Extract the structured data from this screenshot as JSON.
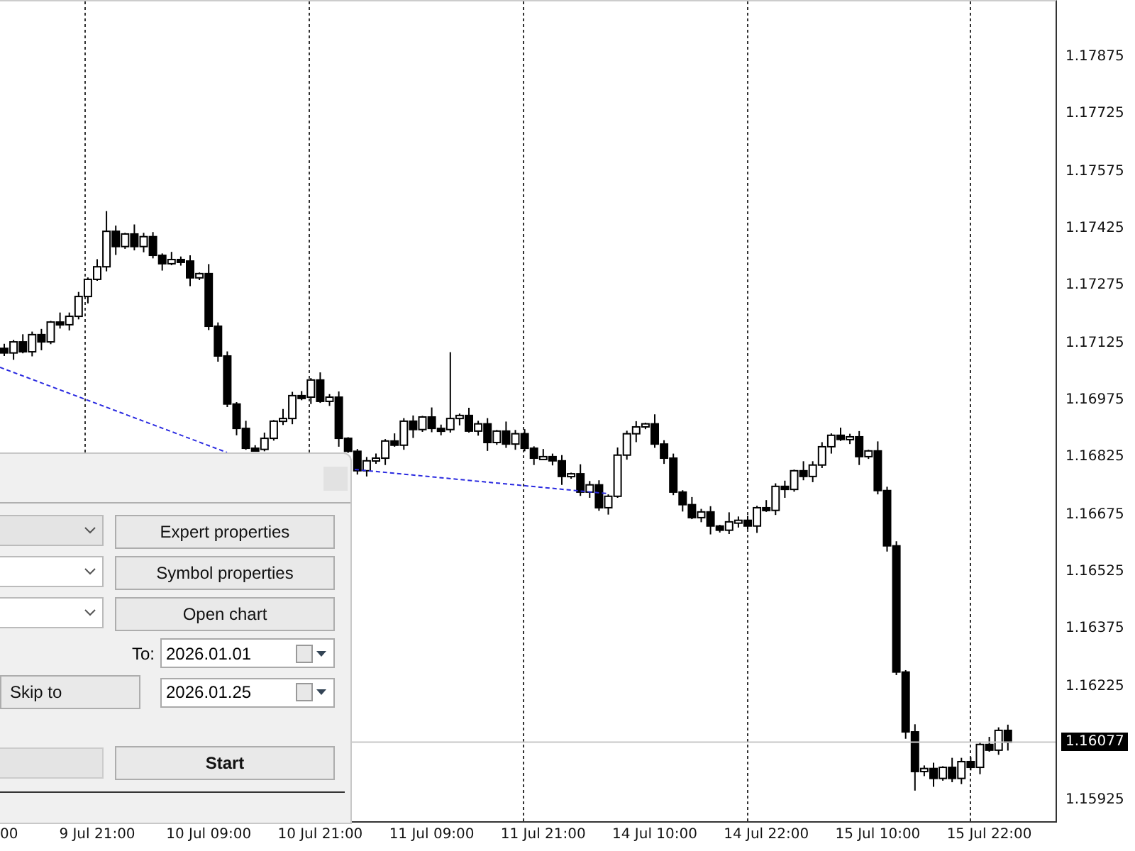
{
  "chart": {
    "chart_data": {
      "type": "candlestick",
      "ylim": [
        1.15866,
        1.1802
      ],
      "categories": [
        null,
        null,
        null,
        null,
        null,
        null,
        null,
        null,
        null,
        null,
        "9 Jul 21:00",
        null,
        null,
        null,
        null,
        null,
        null,
        null,
        null,
        null,
        null,
        null,
        "10 Jul 09:00",
        null,
        null,
        null,
        null,
        null,
        null,
        null,
        null,
        null,
        null,
        null,
        "10 Jul 21:00",
        null,
        null,
        null,
        null,
        null,
        null,
        null,
        null,
        null,
        null,
        null,
        "11 Jul 09:00",
        null,
        null,
        null,
        null,
        null,
        null,
        null,
        null,
        null,
        null,
        null,
        "11 Jul 21:00",
        null,
        null,
        null,
        null,
        null,
        null,
        null,
        null,
        null,
        null,
        null,
        "14 Jul 10:00",
        null,
        null,
        null,
        null,
        null,
        null,
        null,
        null,
        null,
        null,
        null,
        "14 Jul 22:00",
        null,
        null,
        null,
        null,
        null,
        null,
        null,
        null,
        null,
        null,
        null,
        "15 Jul 10:00",
        null,
        null,
        null,
        null,
        null,
        null,
        null,
        null,
        null,
        null,
        null,
        "15 Jul 22:00",
        null,
        null
      ],
      "ohlc": [
        [
          1.1711,
          1.17122,
          1.1709,
          1.17098
        ],
        [
          1.17098,
          1.17132,
          1.1708,
          1.17127
        ],
        [
          1.17127,
          1.17147,
          1.17097,
          1.17101
        ],
        [
          1.17101,
          1.17154,
          1.17089,
          1.17146
        ],
        [
          1.17146,
          1.17161,
          1.17105,
          1.17127
        ],
        [
          1.17127,
          1.17182,
          1.17121,
          1.17179
        ],
        [
          1.17179,
          1.17204,
          1.17162,
          1.17172
        ],
        [
          1.17172,
          1.17204,
          1.17157,
          1.17194
        ],
        [
          1.17194,
          1.17258,
          1.17186,
          1.17246
        ],
        [
          1.17246,
          1.17296,
          1.17228,
          1.17291
        ],
        [
          1.17291,
          1.17344,
          1.17287,
          1.17324
        ],
        [
          1.17324,
          1.1747,
          1.17312,
          1.17417
        ],
        [
          1.17417,
          1.17432,
          1.17355,
          1.17377
        ],
        [
          1.17377,
          1.17413,
          1.17371,
          1.1741
        ],
        [
          1.1741,
          1.17435,
          1.17367,
          1.17377
        ],
        [
          1.17377,
          1.17413,
          1.17362,
          1.17403
        ],
        [
          1.17403,
          1.17415,
          1.17346,
          1.17354
        ],
        [
          1.17354,
          1.17359,
          1.17314,
          1.17332
        ],
        [
          1.17332,
          1.17363,
          1.17328,
          1.17343
        ],
        [
          1.17343,
          1.17351,
          1.17327,
          1.17339
        ],
        [
          1.17339,
          1.17354,
          1.17273,
          1.17295
        ],
        [
          1.17295,
          1.17309,
          1.17289,
          1.17306
        ],
        [
          1.17306,
          1.17331,
          1.17158,
          1.17168
        ],
        [
          1.17168,
          1.17178,
          1.17075,
          1.1709
        ],
        [
          1.1709,
          1.17102,
          1.16956,
          1.16964
        ],
        [
          1.16964,
          1.16969,
          1.16882,
          1.169
        ],
        [
          1.169,
          1.1692,
          1.16844,
          1.16848
        ],
        [
          1.16848,
          1.16856,
          1.1684,
          1.16845
        ],
        [
          1.16845,
          1.16889,
          1.1684,
          1.16874
        ],
        [
          1.16874,
          1.16922,
          1.16868,
          1.16919
        ],
        [
          1.16919,
          1.16951,
          1.16909,
          1.16926
        ],
        [
          1.16926,
          1.16996,
          1.16911,
          1.16986
        ],
        [
          1.16986,
          1.16998,
          1.16974,
          1.16982
        ],
        [
          1.16982,
          1.17032,
          1.16964,
          1.17027
        ],
        [
          1.17027,
          1.17047,
          1.16967,
          1.16971
        ],
        [
          1.16971,
          1.1699,
          1.16959,
          1.16982
        ],
        [
          1.16982,
          1.16997,
          1.16852,
          1.16874
        ],
        [
          1.16874,
          1.16877,
          1.16836,
          1.1684
        ],
        [
          1.1684,
          1.16846,
          1.16779,
          1.16789
        ],
        [
          1.16789,
          1.16825,
          1.16774,
          1.16815
        ],
        [
          1.16815,
          1.16834,
          1.16807,
          1.16822
        ],
        [
          1.16822,
          1.16872,
          1.16804,
          1.16867
        ],
        [
          1.16867,
          1.16887,
          1.16852,
          1.16856
        ],
        [
          1.16856,
          1.16927,
          1.16844,
          1.16919
        ],
        [
          1.16919,
          1.16934,
          1.16875,
          1.16897
        ],
        [
          1.16897,
          1.16933,
          1.16891,
          1.1693
        ],
        [
          1.1693,
          1.16955,
          1.1689,
          1.169
        ],
        [
          1.169,
          1.1691,
          1.16882,
          1.16897
        ],
        [
          1.16897,
          1.171,
          1.16889,
          1.16926
        ],
        [
          1.16926,
          1.16939,
          1.16908,
          1.16934
        ],
        [
          1.16934,
          1.16954,
          1.16889,
          1.16893
        ],
        [
          1.16893,
          1.1692,
          1.16881,
          1.16912
        ],
        [
          1.16912,
          1.16927,
          1.16841,
          1.16863
        ],
        [
          1.16863,
          1.16896,
          1.16857,
          1.16893
        ],
        [
          1.16893,
          1.16918,
          1.16849,
          1.16859
        ],
        [
          1.16859,
          1.16896,
          1.16844,
          1.16886
        ],
        [
          1.16886,
          1.16898,
          1.1684,
          1.16848
        ],
        [
          1.16848,
          1.16853,
          1.16804,
          1.16822
        ],
        [
          1.16822,
          1.16846,
          1.16818,
          1.16826
        ],
        [
          1.16826,
          1.16834,
          1.16803,
          1.16815
        ],
        [
          1.16815,
          1.1683,
          1.16752,
          1.16774
        ],
        [
          1.16774,
          1.16784,
          1.16768,
          1.16781
        ],
        [
          1.16781,
          1.16806,
          1.16723,
          1.16733
        ],
        [
          1.16733,
          1.16762,
          1.16718,
          1.16752
        ],
        [
          1.16752,
          1.16764,
          1.16684,
          1.16692
        ],
        [
          1.16692,
          1.16727,
          1.16674,
          1.16722
        ],
        [
          1.16722,
          1.1685,
          1.16718,
          1.1683
        ],
        [
          1.1683,
          1.16894,
          1.16818,
          1.16886
        ],
        [
          1.16886,
          1.16919,
          1.16864,
          1.16904
        ],
        [
          1.16904,
          1.16915,
          1.16898,
          1.16912
        ],
        [
          1.16912,
          1.16937,
          1.16849,
          1.16859
        ],
        [
          1.16859,
          1.16869,
          1.16807,
          1.16822
        ],
        [
          1.16822,
          1.16834,
          1.16725,
          1.16733
        ],
        [
          1.16733,
          1.16738,
          1.16682,
          1.167
        ],
        [
          1.167,
          1.1672,
          1.16662,
          1.16666
        ],
        [
          1.16666,
          1.16689,
          1.16654,
          1.16681
        ],
        [
          1.16681,
          1.16696,
          1.16622,
          1.16644
        ],
        [
          1.16644,
          1.16647,
          1.16627,
          1.16633
        ],
        [
          1.16633,
          1.1668,
          1.16623,
          1.16655
        ],
        [
          1.16655,
          1.16669,
          1.1664,
          1.16659
        ],
        [
          1.16659,
          1.16671,
          1.16636,
          1.16644
        ],
        [
          1.16644,
          1.16697,
          1.16626,
          1.16692
        ],
        [
          1.16692,
          1.16712,
          1.16681,
          1.16685
        ],
        [
          1.16685,
          1.16756,
          1.16673,
          1.16748
        ],
        [
          1.16748,
          1.16763,
          1.16718,
          1.1674
        ],
        [
          1.1674,
          1.16792,
          1.16734,
          1.16789
        ],
        [
          1.16789,
          1.16814,
          1.16764,
          1.16774
        ],
        [
          1.16774,
          1.16814,
          1.16759,
          1.16804
        ],
        [
          1.16804,
          1.16864,
          1.16796,
          1.16852
        ],
        [
          1.16852,
          1.16887,
          1.16834,
          1.16882
        ],
        [
          1.16882,
          1.16902,
          1.16867,
          1.16871
        ],
        [
          1.16871,
          1.16886,
          1.16859,
          1.16878
        ],
        [
          1.16878,
          1.16893,
          1.16804,
          1.16826
        ],
        [
          1.16826,
          1.16844,
          1.1682,
          1.16841
        ],
        [
          1.16841,
          1.16866,
          1.16727,
          1.16737
        ],
        [
          1.16737,
          1.16747,
          1.16577,
          1.16592
        ],
        [
          1.16592,
          1.16604,
          1.16253,
          1.16261
        ],
        [
          1.16261,
          1.16266,
          1.16086,
          1.16104
        ],
        [
          1.16104,
          1.16124,
          1.1595,
          1.16
        ],
        [
          1.16,
          1.16016,
          1.15988,
          1.16008
        ],
        [
          1.16008,
          1.16023,
          1.1596,
          1.15982
        ],
        [
          1.15982,
          1.16014,
          1.15976,
          1.16011
        ],
        [
          1.16011,
          1.16036,
          1.15972,
          1.15982
        ],
        [
          1.15982,
          1.16036,
          1.15967,
          1.16026
        ],
        [
          1.16026,
          1.16038,
          1.16003,
          1.16011
        ],
        [
          1.16011,
          1.16076,
          1.15993,
          1.16071
        ],
        [
          1.16071,
          1.16091,
          1.16052,
          1.16056
        ],
        [
          1.16056,
          1.16116,
          1.16044,
          1.16108
        ],
        [
          1.16108,
          1.16123,
          1.16055,
          1.16077
        ]
      ],
      "yticks": [
        {
          "value": 1.17875,
          "label": "1.17875"
        },
        {
          "value": 1.17725,
          "label": "1.17725"
        },
        {
          "value": 1.17575,
          "label": "1.17575"
        },
        {
          "value": 1.17425,
          "label": "1.17425"
        },
        {
          "value": 1.17275,
          "label": "1.17275"
        },
        {
          "value": 1.17125,
          "label": "1.17125"
        },
        {
          "value": 1.16975,
          "label": "1.16975"
        },
        {
          "value": 1.16825,
          "label": "1.16825"
        },
        {
          "value": 1.16675,
          "label": "1.16675"
        },
        {
          "value": 1.16525,
          "label": "1.16525"
        },
        {
          "value": 1.16375,
          "label": "1.16375"
        },
        {
          "value": 1.16225,
          "label": "1.16225"
        },
        {
          "value": 1.15925,
          "label": "1.15925"
        }
      ]
    },
    "current_price": "1.16077",
    "time_axis_start": "00"
  },
  "tester_panel": {
    "selectors": [
      {
        "disabled": true
      },
      {
        "disabled": false
      },
      {
        "disabled": false
      }
    ],
    "buttons": [
      {
        "label": "Expert properties"
      },
      {
        "label": "Symbol properties"
      },
      {
        "label": "Open chart"
      }
    ],
    "to_label": "To:",
    "to_date": "2026.01.01",
    "skip_button": "Skip to",
    "skip_date": "2026.01.25",
    "progress": {
      "level": 0
    },
    "start_button": "Start"
  }
}
